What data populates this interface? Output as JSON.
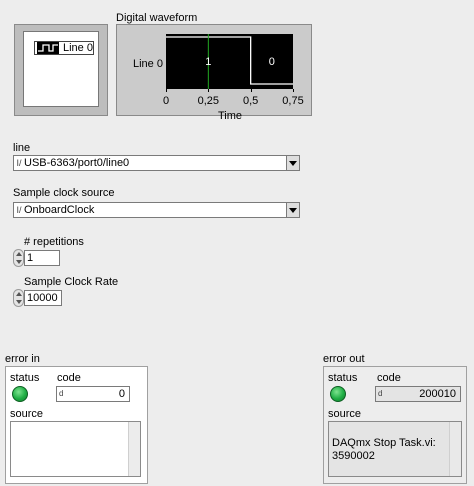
{
  "waveform": {
    "title": "Digital waveform",
    "legend_label": "Line 0",
    "y_label": "Line 0",
    "x_label": "Time",
    "x_ticks": [
      "0",
      "0,25",
      "0,5",
      "0,75"
    ],
    "state_labels": [
      "1",
      "0"
    ]
  },
  "chart_data": {
    "type": "line",
    "x_range": [
      0,
      0.75
    ],
    "transition_at": 0.5,
    "states": [
      1,
      0
    ],
    "cursor_at": 0.25,
    "colors": {
      "background": "#000000",
      "line": "#ffffff",
      "cursor": "#22aa22"
    }
  },
  "line": {
    "label": "line",
    "prefix": "I/",
    "value": "USB-6363/port0/line0"
  },
  "sample_clock_source": {
    "label": "Sample clock source",
    "prefix": "I/",
    "value": "OnboardClock"
  },
  "repetitions": {
    "label": "# repetitions",
    "value": "1"
  },
  "sample_clock_rate": {
    "label": "Sample Clock Rate",
    "value": "10000"
  },
  "error_in": {
    "title": "error in",
    "status_label": "status",
    "code_label": "code",
    "code_prefix": "d",
    "code_value": "0",
    "source_label": "source",
    "source_value": ""
  },
  "error_out": {
    "title": "error out",
    "status_label": "status",
    "code_label": "code",
    "code_prefix": "d",
    "code_value": "200010",
    "source_label": "source",
    "source_value": "DAQmx Stop Task.vi:\n3590002"
  }
}
